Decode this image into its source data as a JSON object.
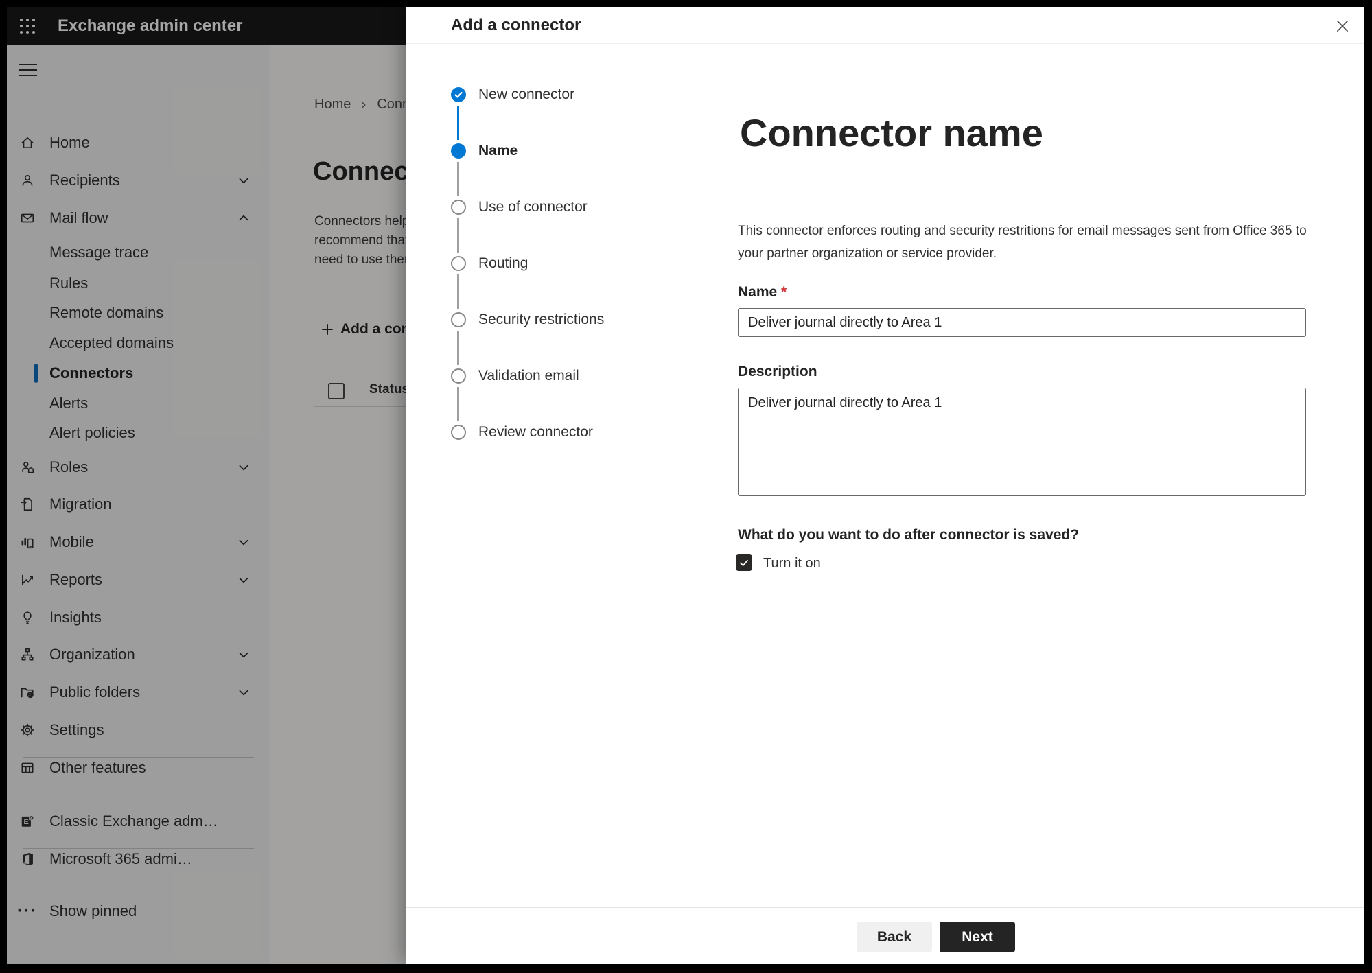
{
  "topbar": {
    "title": "Exchange admin center"
  },
  "sidebar": {
    "items": [
      {
        "label": "Home",
        "icon": "home-icon"
      },
      {
        "label": "Recipients",
        "icon": "person-icon",
        "chevron": "down"
      },
      {
        "label": "Mail flow",
        "icon": "mail-icon",
        "chevron": "up",
        "expanded": true
      },
      {
        "label": "Message trace",
        "indent": true
      },
      {
        "label": "Rules",
        "indent": true
      },
      {
        "label": "Remote domains",
        "indent": true
      },
      {
        "label": "Accepted domains",
        "indent": true
      },
      {
        "label": "Connectors",
        "indent": true,
        "selected": true
      },
      {
        "label": "Alerts",
        "indent": true
      },
      {
        "label": "Alert policies",
        "indent": true
      },
      {
        "label": "Roles",
        "icon": "person-badge-icon",
        "chevron": "down"
      },
      {
        "label": "Migration",
        "icon": "migration-icon"
      },
      {
        "label": "Mobile",
        "icon": "mobile-chart-icon",
        "chevron": "down"
      },
      {
        "label": "Reports",
        "icon": "report-chart-icon",
        "chevron": "down"
      },
      {
        "label": "Insights",
        "icon": "lightbulb-icon"
      },
      {
        "label": "Organization",
        "icon": "org-chart-icon",
        "chevron": "down"
      },
      {
        "label": "Public folders",
        "icon": "folder-globe-icon",
        "chevron": "down"
      },
      {
        "label": "Settings",
        "icon": "gear-icon"
      },
      {
        "label": "Other features",
        "icon": "grid-icon"
      },
      {
        "label": "Classic Exchange adm…",
        "icon": "exchange-logo-icon"
      },
      {
        "label": "Microsoft 365 admi…",
        "icon": "office-logo-icon"
      },
      {
        "label": "Show pinned",
        "icon": "ellipsis-icon"
      }
    ]
  },
  "page": {
    "breadcrumb": {
      "home": "Home",
      "current": "Conne"
    },
    "title": "Connec",
    "intro_lines": [
      "Connectors help",
      "recommend that",
      "need to use ther"
    ],
    "add_button": "Add a conn",
    "table": {
      "status_header": "Status"
    }
  },
  "dialog": {
    "title": "Add a connector",
    "steps": [
      {
        "label": "New connector",
        "state": "done"
      },
      {
        "label": "Name",
        "state": "current"
      },
      {
        "label": "Use of connector",
        "state": "todo"
      },
      {
        "label": "Routing",
        "state": "todo"
      },
      {
        "label": "Security restrictions",
        "state": "todo"
      },
      {
        "label": "Validation email",
        "state": "todo"
      },
      {
        "label": "Review connector",
        "state": "todo"
      }
    ],
    "content": {
      "heading": "Connector name",
      "description": "This connector enforces routing and security restritions for email messages sent from Office 365 to your partner organization or service provider.",
      "name_label": "Name",
      "required_marker": "*",
      "name_value": "Deliver journal directly to Area 1",
      "description_label": "Description",
      "description_value": "Deliver journal directly to Area 1",
      "question": "What do you want to do after connector is saved?",
      "turn_on_label": "Turn it on",
      "turn_on_checked": true
    },
    "footer": {
      "back": "Back",
      "next": "Next"
    }
  },
  "colors": {
    "accent_blue": "#0078d4",
    "topbar_bg": "#1b1a19",
    "sidebar_bg": "#f3f2f1",
    "primary_button_bg": "#242424",
    "required_red": "#d13438",
    "checkbox_bg": "#292827"
  }
}
